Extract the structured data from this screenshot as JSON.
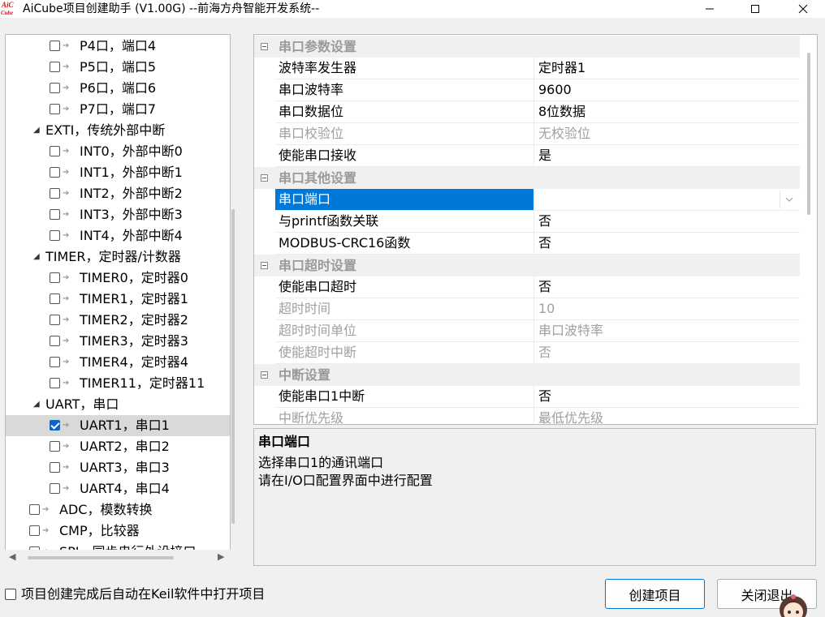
{
  "window": {
    "title": "AiCube项目创建助手 (V1.00G) --前海方舟智能开发系统--",
    "logo_text_top": "AiC",
    "logo_text_bottom": "Cube"
  },
  "tree": {
    "rows": [
      {
        "label": "P4口，端口4",
        "type": "item",
        "level": 2,
        "checked": false
      },
      {
        "label": "P5口，端口5",
        "type": "item",
        "level": 2,
        "checked": false
      },
      {
        "label": "P6口，端口6",
        "type": "item",
        "level": 2,
        "checked": false
      },
      {
        "label": "P7口，端口7",
        "type": "item",
        "level": 2,
        "checked": false
      },
      {
        "label": "EXTI，传统外部中断",
        "type": "group",
        "level": 1
      },
      {
        "label": "INT0，外部中断0",
        "type": "item",
        "level": 2,
        "checked": false
      },
      {
        "label": "INT1，外部中断1",
        "type": "item",
        "level": 2,
        "checked": false
      },
      {
        "label": "INT2，外部中断2",
        "type": "item",
        "level": 2,
        "checked": false
      },
      {
        "label": "INT3，外部中断3",
        "type": "item",
        "level": 2,
        "checked": false
      },
      {
        "label": "INT4，外部中断4",
        "type": "item",
        "level": 2,
        "checked": false
      },
      {
        "label": "TIMER，定时器/计数器",
        "type": "group",
        "level": 1
      },
      {
        "label": "TIMER0，定时器0",
        "type": "item",
        "level": 2,
        "checked": false
      },
      {
        "label": "TIMER1，定时器1",
        "type": "item",
        "level": 2,
        "checked": false
      },
      {
        "label": "TIMER2，定时器2",
        "type": "item",
        "level": 2,
        "checked": false
      },
      {
        "label": "TIMER3，定时器3",
        "type": "item",
        "level": 2,
        "checked": false
      },
      {
        "label": "TIMER4，定时器4",
        "type": "item",
        "level": 2,
        "checked": false
      },
      {
        "label": "TIMER11，定时器11",
        "type": "item",
        "level": 2,
        "checked": false
      },
      {
        "label": "UART，串口",
        "type": "group",
        "level": 1
      },
      {
        "label": "UART1，串口1",
        "type": "item",
        "level": 2,
        "checked": true,
        "selected": true
      },
      {
        "label": "UART2，串口2",
        "type": "item",
        "level": 2,
        "checked": false
      },
      {
        "label": "UART3，串口3",
        "type": "item",
        "level": 2,
        "checked": false
      },
      {
        "label": "UART4，串口4",
        "type": "item",
        "level": 2,
        "checked": false
      },
      {
        "label": "ADC，模数转换",
        "type": "item",
        "level": 1,
        "checked": false
      },
      {
        "label": "CMP，比较器",
        "type": "item",
        "level": 1,
        "checked": false
      },
      {
        "label": "SPI，同步串行外设接口",
        "type": "item",
        "level": 1,
        "checked": false
      }
    ]
  },
  "property_grid": {
    "rows": [
      {
        "kind": "category",
        "label": "串口参数设置"
      },
      {
        "kind": "prop",
        "name": "波特率发生器",
        "value": "定时器1"
      },
      {
        "kind": "prop",
        "name": "串口波特率",
        "value": "9600"
      },
      {
        "kind": "prop",
        "name": "串口数据位",
        "value": "8位数据"
      },
      {
        "kind": "prop",
        "name": "串口校验位",
        "value": "无校验位",
        "disabled": true
      },
      {
        "kind": "prop",
        "name": "使能串口接收",
        "value": "是"
      },
      {
        "kind": "category",
        "label": "串口其他设置"
      },
      {
        "kind": "prop",
        "name": "串口端口",
        "value": "",
        "selected": true,
        "dropdown": true
      },
      {
        "kind": "prop",
        "name": "与printf函数关联",
        "value": "否"
      },
      {
        "kind": "prop",
        "name": "MODBUS-CRC16函数",
        "value": "否"
      },
      {
        "kind": "category",
        "label": "串口超时设置"
      },
      {
        "kind": "prop",
        "name": "使能串口超时",
        "value": "否"
      },
      {
        "kind": "prop",
        "name": "超时时间",
        "value": "10",
        "disabled": true
      },
      {
        "kind": "prop",
        "name": "超时时间单位",
        "value": "串口波特率",
        "disabled": true
      },
      {
        "kind": "prop",
        "name": "使能超时中断",
        "value": "否",
        "disabled": true
      },
      {
        "kind": "category",
        "label": "中断设置"
      },
      {
        "kind": "prop",
        "name": "使能串口1中断",
        "value": "否"
      },
      {
        "kind": "prop",
        "name": "中断优先级",
        "value": "最低优先级",
        "disabled": true
      }
    ]
  },
  "description": {
    "title": "串口端口",
    "lines": [
      "选择串口1的通讯端口",
      "请在I/O口配置界面中进行配置"
    ]
  },
  "footer": {
    "auto_open_label": "项目创建完成后自动在Keil软件中打开项目",
    "auto_open_checked": false,
    "create_button": "创建项目",
    "close_button": "关闭退出"
  },
  "colors": {
    "selection": "#0078d7",
    "checkbox_checked": "#0a66c8"
  }
}
